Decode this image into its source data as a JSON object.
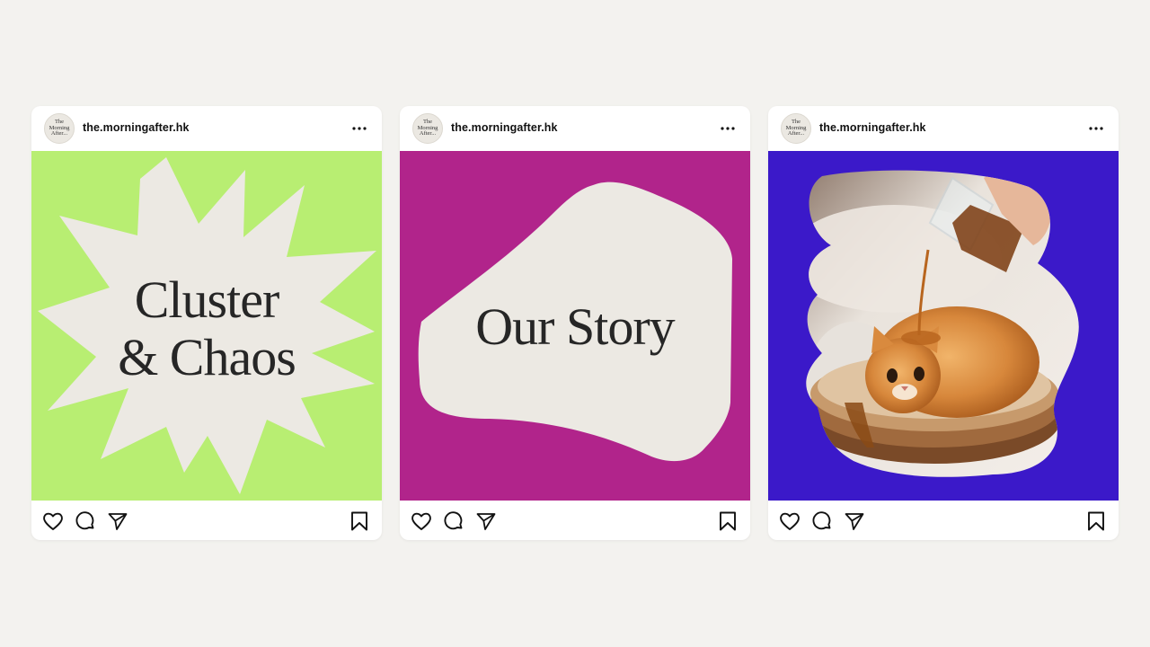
{
  "colors": {
    "page_background": "#f3f2ef",
    "card_background": "#ffffff",
    "shape_fill": "#ece9e3",
    "text_dark": "#262626"
  },
  "icons": {
    "more": "more-horizontal-icon",
    "like": "heart-icon",
    "comment": "comment-bubble-icon",
    "share": "paper-plane-icon",
    "save": "bookmark-icon"
  },
  "posts": [
    {
      "username": "the.morningafter.hk",
      "avatar_text": "The\nMorning\nAfter...",
      "media_background": "#b8ee72",
      "headline_lines": [
        "Cluster",
        "& Chaos"
      ]
    },
    {
      "username": "the.morningafter.hk",
      "avatar_text": "The\nMorning\nAfter...",
      "media_background": "#b1248b",
      "headline_lines": [
        "Our Story"
      ]
    },
    {
      "username": "the.morningafter.hk",
      "avatar_text": "The\nMorning\nAfter...",
      "media_background": "#3b19c9",
      "image_description": "cat-with-syrup-photo"
    }
  ]
}
